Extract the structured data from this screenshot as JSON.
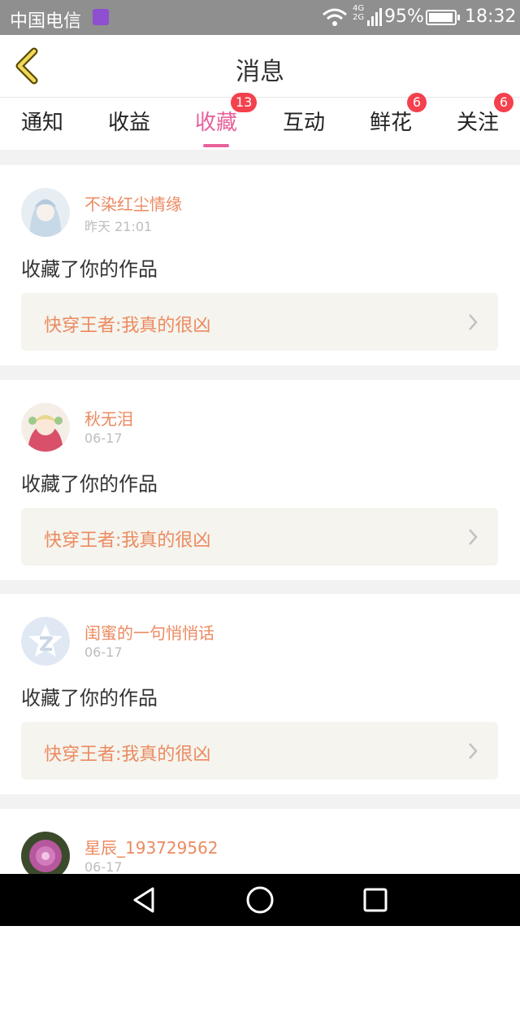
{
  "status_bar": {
    "carrier": "中国电信",
    "network_top": "4G",
    "network_bottom": "2G",
    "battery": "95%",
    "time": "18:32"
  },
  "header": {
    "title": "消息",
    "back_icon": "chevron-left-icon"
  },
  "tabs": [
    {
      "label": "通知",
      "badge": ""
    },
    {
      "label": "收益",
      "badge": ""
    },
    {
      "label": "收藏",
      "badge": "13",
      "active": true
    },
    {
      "label": "互动",
      "badge": ""
    },
    {
      "label": "鲜花",
      "badge": "6"
    },
    {
      "label": "关注",
      "badge": "6"
    }
  ],
  "notifications": [
    {
      "user": "不染红尘情缘",
      "time": "昨天 21:01",
      "action": "收藏了你的作品",
      "work": "快穿王者:我真的很凶"
    },
    {
      "user": "秋无泪",
      "time": "06-17",
      "action": "收藏了你的作品",
      "work": "快穿王者:我真的很凶"
    },
    {
      "user": "闺蜜的一句悄悄话",
      "time": "06-17",
      "action": "收藏了你的作品",
      "work": "快穿王者:我真的很凶"
    },
    {
      "user": "星辰_193729562",
      "time": "06-17",
      "action": "",
      "work": ""
    }
  ],
  "colors": {
    "accent": "#e8609a",
    "username": "#ec8a60",
    "badge": "#f4414d",
    "work_bg": "#f5f4ee"
  }
}
